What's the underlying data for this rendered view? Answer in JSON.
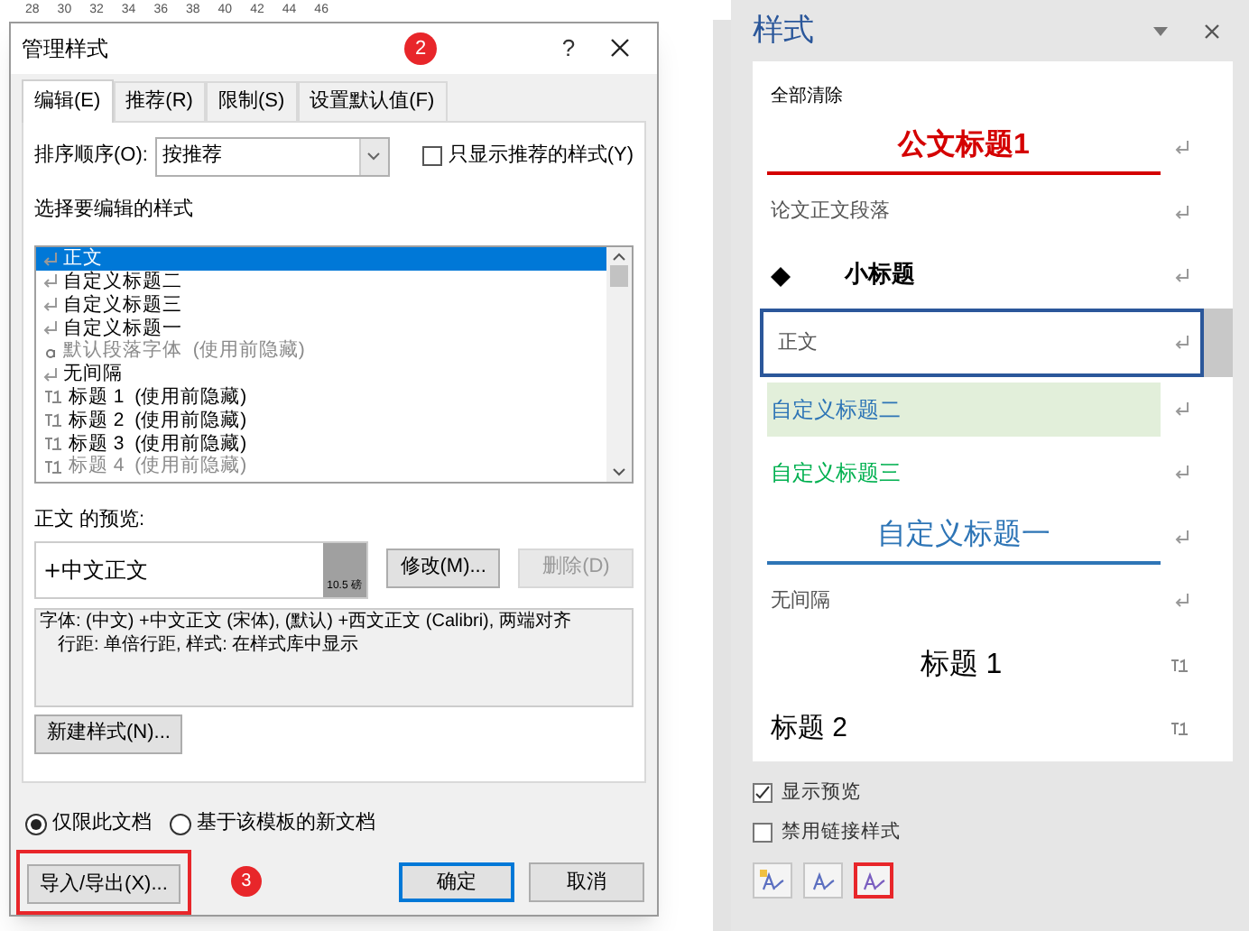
{
  "ruler": [
    "28",
    "30",
    "32",
    "34",
    "36",
    "38",
    "40",
    "42",
    "44",
    "46"
  ],
  "dialog": {
    "title": "管理样式",
    "help": "?",
    "annotation": "2",
    "tabs": [
      {
        "label": "编辑(E)",
        "selected": true
      },
      {
        "label": "推荐(R)",
        "selected": false
      },
      {
        "label": "限制(S)",
        "selected": false
      },
      {
        "label": "设置默认值(F)",
        "selected": false
      }
    ],
    "sort_label": "排序顺序(O):",
    "sort_value": "按推荐",
    "recommended_only": {
      "label": "只显示推荐的样式(Y)",
      "checked": false
    },
    "list_label": "选择要编辑的样式",
    "styles": [
      {
        "kind": "paragraph",
        "name": "正文",
        "selected": true,
        "dimmed": false
      },
      {
        "kind": "paragraph",
        "name": "自定义标题二",
        "selected": false,
        "dimmed": false
      },
      {
        "kind": "paragraph",
        "name": "自定义标题三",
        "selected": false,
        "dimmed": false
      },
      {
        "kind": "paragraph",
        "name": "自定义标题一",
        "selected": false,
        "dimmed": false
      },
      {
        "kind": "character",
        "name": "默认段落字体  (使用前隐藏)",
        "selected": false,
        "dimmed": true
      },
      {
        "kind": "paragraph",
        "name": "无间隔",
        "selected": false,
        "dimmed": false
      },
      {
        "kind": "linked",
        "name": "标题 1  (使用前隐藏)",
        "selected": false,
        "dimmed": false
      },
      {
        "kind": "linked",
        "name": "标题 2  (使用前隐藏)",
        "selected": false,
        "dimmed": false
      },
      {
        "kind": "linked",
        "name": "标题 3  (使用前隐藏)",
        "selected": false,
        "dimmed": false
      },
      {
        "kind": "linked",
        "name": "标题 4  (使用前隐藏)",
        "selected": false,
        "dimmed": true
      }
    ],
    "preview_label": "正文 的预览:",
    "preview_text": "+中文正文",
    "preview_size": "10.5 磅",
    "modify_button": {
      "label": "修改(M)...",
      "disabled": false
    },
    "delete_button": {
      "label": "删除(D)",
      "disabled": true
    },
    "description": [
      "字体: (中文) +中文正文 (宋体), (默认) +西文正文 (Calibri), 两端对齐",
      "行距: 单倍行距, 样式: 在样式库中显示"
    ],
    "new_style_button": "新建样式(N)...",
    "scope": [
      {
        "label": "仅限此文档",
        "selected": true
      },
      {
        "label": "基于该模板的新文档",
        "selected": false
      }
    ],
    "import_button": {
      "label": "导入/导出(X)...",
      "highlighted": true
    },
    "import_annotation": "3",
    "ok_button": "确定",
    "cancel_button": "取消"
  },
  "pane": {
    "title": "样式",
    "clear_all": "全部清除",
    "items": [
      {
        "kind": "red-title",
        "name": "公文标题1",
        "linked": false,
        "selected": false
      },
      {
        "kind": "serif",
        "name": "论文正文段落",
        "linked": false,
        "selected": false
      },
      {
        "kind": "bullet",
        "name": "小标题",
        "linked": false,
        "selected": false
      },
      {
        "kind": "serif",
        "name": "正文",
        "linked": false,
        "selected": true
      },
      {
        "kind": "shaded",
        "name": "自定义标题二",
        "linked": false,
        "selected": false
      },
      {
        "kind": "green",
        "name": "自定义标题三",
        "linked": false,
        "selected": false
      },
      {
        "kind": "blue-title",
        "name": "自定义标题一",
        "linked": false,
        "selected": false
      },
      {
        "kind": "serif",
        "name": "无间隔",
        "linked": false,
        "selected": false
      },
      {
        "kind": "centered-large",
        "name": "标题 1",
        "linked": true,
        "selected": false
      },
      {
        "kind": "large",
        "name": "标题 2",
        "linked": true,
        "selected": false
      }
    ],
    "options": [
      {
        "label": "显示预览",
        "checked": true
      },
      {
        "label": "禁用链接样式",
        "checked": false
      }
    ],
    "buttons": [
      {
        "kind": "new-style",
        "highlighted": false
      },
      {
        "kind": "inspector",
        "highlighted": false
      },
      {
        "kind": "manage",
        "highlighted": true
      }
    ]
  }
}
